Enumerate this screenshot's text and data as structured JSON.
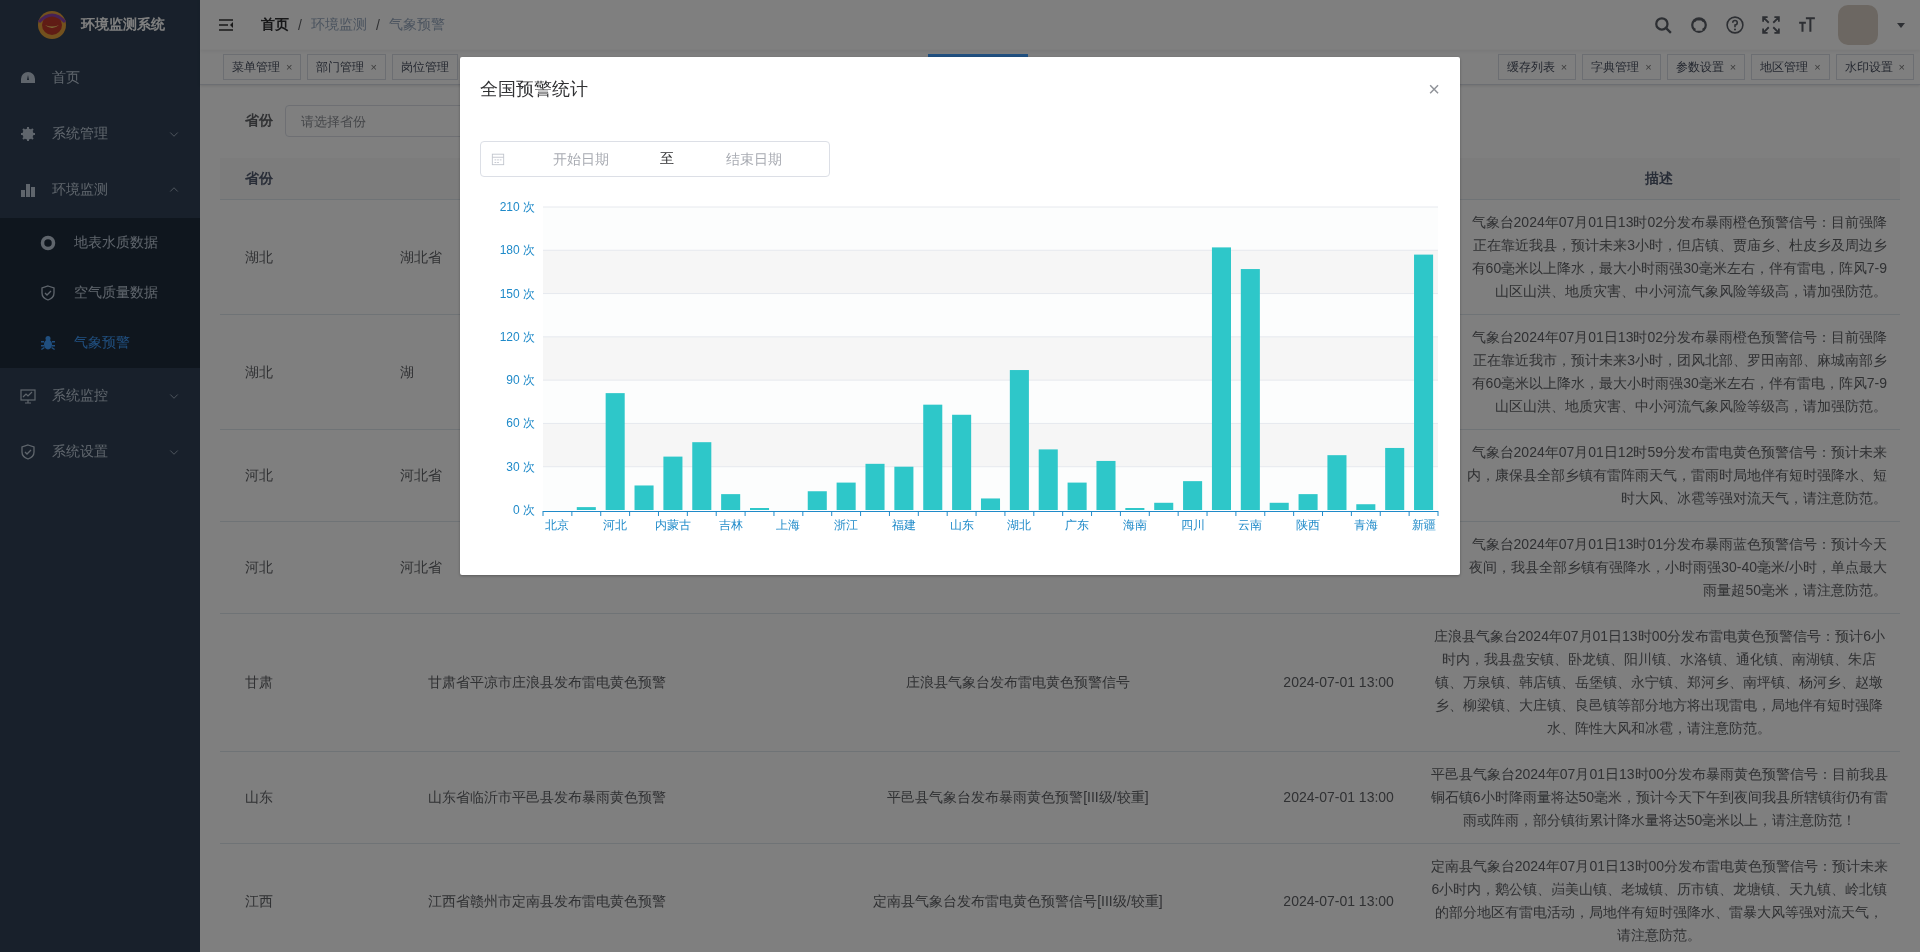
{
  "sidebar": {
    "title": "环境监测系统",
    "items": [
      {
        "label": "首页",
        "selected": false
      },
      {
        "label": "系统管理",
        "selected": false,
        "expanded": false
      },
      {
        "label": "环境监测",
        "selected": false,
        "expanded": true,
        "children": [
          {
            "label": "地表水质数据",
            "selected": false
          },
          {
            "label": "空气质量数据",
            "selected": false
          },
          {
            "label": "气象预警",
            "selected": true
          }
        ]
      },
      {
        "label": "系统监控",
        "selected": false,
        "expanded": false
      },
      {
        "label": "系统设置",
        "selected": false,
        "expanded": false
      }
    ]
  },
  "navbar": {
    "breadcrumb": [
      {
        "label": "首页",
        "link": true
      },
      {
        "separator": "/",
        "label": "环境监测",
        "link": false
      },
      {
        "separator": "/",
        "label": "气象预警",
        "link": false
      }
    ]
  },
  "tags": [
    {
      "label": "菜单管理",
      "close": "×",
      "selected": false
    },
    {
      "label": "部门管理",
      "close": "×",
      "selected": false
    },
    {
      "label": "岗位管理",
      "selected": false
    },
    {
      "selected": true
    },
    {
      "label": "缓存列表",
      "close": "×",
      "selected": false
    },
    {
      "label": "字典管理",
      "close": "×",
      "selected": false
    },
    {
      "label": "参数设置",
      "close": "×",
      "selected": false
    },
    {
      "label": "地区管理",
      "close": "×",
      "selected": false
    },
    {
      "label": "水印设置",
      "close": "×",
      "selected": false
    }
  ],
  "search": {
    "label": "省份",
    "placeholder": "请选择省份"
  },
  "table": {
    "header": {
      "column_1": "省份",
      "column_5": "描述"
    },
    "rows": [
      {
        "column_1": "湖北",
        "column_2": "湖北省",
        "column_5": [
          "气象台2024年07月01日13时02分发布暴雨橙色预警信号：目前强降",
          "正在靠近我县，预计未来3小时，但店镇、贾庙乡、杜皮乡及周边乡",
          "有60毫米以上降水，最大小时雨强30毫米左右，伴有雷电，阵风7-9",
          "山区山洪、地质灾害、中小河流气象风险等级高，请加强防范。"
        ]
      },
      {
        "column_1": "湖北",
        "column_2": "湖",
        "column_5": [
          "气象台2024年07月01日13时02分发布暴雨橙色预警信号：目前强降",
          "正在靠近我市，预计未来3小时，团风北部、罗田南部、麻城南部乡",
          "有60毫米以上降水，最大小时雨强30毫米左右，伴有雷电，阵风7-9",
          "山区山洪、地质灾害、中小河流气象风险等级高，请加强防范。"
        ]
      },
      {
        "column_1": "河北",
        "column_2": "河北省",
        "column_5": [
          "气象台2024年07月01日12时59分发布雷电黄色预警信号：预计未来",
          "内，康保县全部乡镇有雷阵雨天气，雷雨时局地伴有短时强降水、短",
          "时大风、冰雹等强对流天气，请注意防范。"
        ]
      },
      {
        "column_1": "河北",
        "column_2": "河北省",
        "column_5": [
          "气象台2024年07月01日13时01分发布暴雨蓝色预警信号：预计今天",
          "夜间，我县全部乡镇有强降水，小时雨强30-40毫米/小时，单点最大",
          "雨量超50毫米，请注意防范。"
        ]
      },
      {
        "column_1": "甘肃",
        "column_2": "甘肃省平凉市庄浪县发布雷电黄色预警",
        "column_3": "庄浪县气象台发布雷电黄色预警信号",
        "column_4": "2024-07-01 13:00",
        "column_5": "庄浪县气象台2024年07月01日13时00分发布雷电黄色预警信号：预计6小时内，我县盘安镇、卧龙镇、阳川镇、水洛镇、通化镇、南湖镇、朱店镇、万泉镇、韩店镇、岳堡镇、永宁镇、郑河乡、南坪镇、杨河乡、赵墩乡、柳梁镇、大庄镇、良邑镇等部分地方将出现雷电，局地伴有短时强降水、阵性大风和冰雹，请注意防范。"
      },
      {
        "column_1": "山东",
        "column_2": "山东省临沂市平邑县发布暴雨黄色预警",
        "column_3": "平邑县气象台发布暴雨黄色预警[III级/较重]",
        "column_4": "2024-07-01 13:00",
        "column_5": "平邑县气象台2024年07月01日13时00分发布暴雨黄色预警信号：目前我县铜石镇6小时降雨量将达50毫米，预计今天下午到夜间我县所辖镇街仍有雷雨或阵雨，部分镇街累计降水量将达50毫米以上，请注意防范！"
      },
      {
        "column_1": "江西",
        "column_2": "江西省赣州市定南县发布雷电黄色预警",
        "column_3": "定南县气象台发布雷电黄色预警信号[III级/较重]",
        "column_4": "2024-07-01 13:00",
        "column_5": "定南县气象台2024年07月01日13时00分发布雷电黄色预警信号：预计未来6小时内，鹅公镇、岿美山镇、老城镇、历市镇、龙塘镇、天九镇、岭北镇的部分地区有雷电活动，局地伴有短时强降水、雷暴大风等强对流天气，请注意防范。"
      }
    ]
  },
  "dialog": {
    "title": "全国预警统计",
    "close": "×",
    "date_range": {
      "start_placeholder": "开始日期",
      "separator": "至",
      "end_placeholder": "结束日期"
    },
    "chart_data": {
      "type": "bar",
      "grid": true,
      "categories": [
        "北京",
        null,
        "河北",
        null,
        "内蒙古",
        null,
        "吉林",
        null,
        "上海",
        null,
        "浙江",
        null,
        "福建",
        null,
        "山东",
        null,
        "湖北",
        null,
        "广东",
        null,
        "海南",
        null,
        "四川",
        null,
        "云南",
        null,
        "陕西",
        null,
        "青海",
        null,
        "新疆"
      ],
      "values": [
        0,
        2,
        81,
        17,
        37,
        47,
        11,
        1,
        0,
        13,
        19,
        32,
        30,
        73,
        66,
        8,
        97,
        42,
        19,
        34,
        1,
        5,
        20,
        182,
        167,
        5,
        11,
        38,
        4,
        43,
        177
      ],
      "ylim": [
        0,
        210
      ],
      "yticks": [
        {
          "value": 0,
          "label": "0 次"
        },
        {
          "value": 30,
          "label": "30 次"
        },
        {
          "value": 60,
          "label": "60 次"
        },
        {
          "value": 90,
          "label": "90 次"
        },
        {
          "value": 120,
          "label": "120 次"
        },
        {
          "value": 150,
          "label": "150 次"
        },
        {
          "value": 180,
          "label": "180 次"
        },
        {
          "value": 210,
          "label": "210 次"
        }
      ]
    }
  }
}
